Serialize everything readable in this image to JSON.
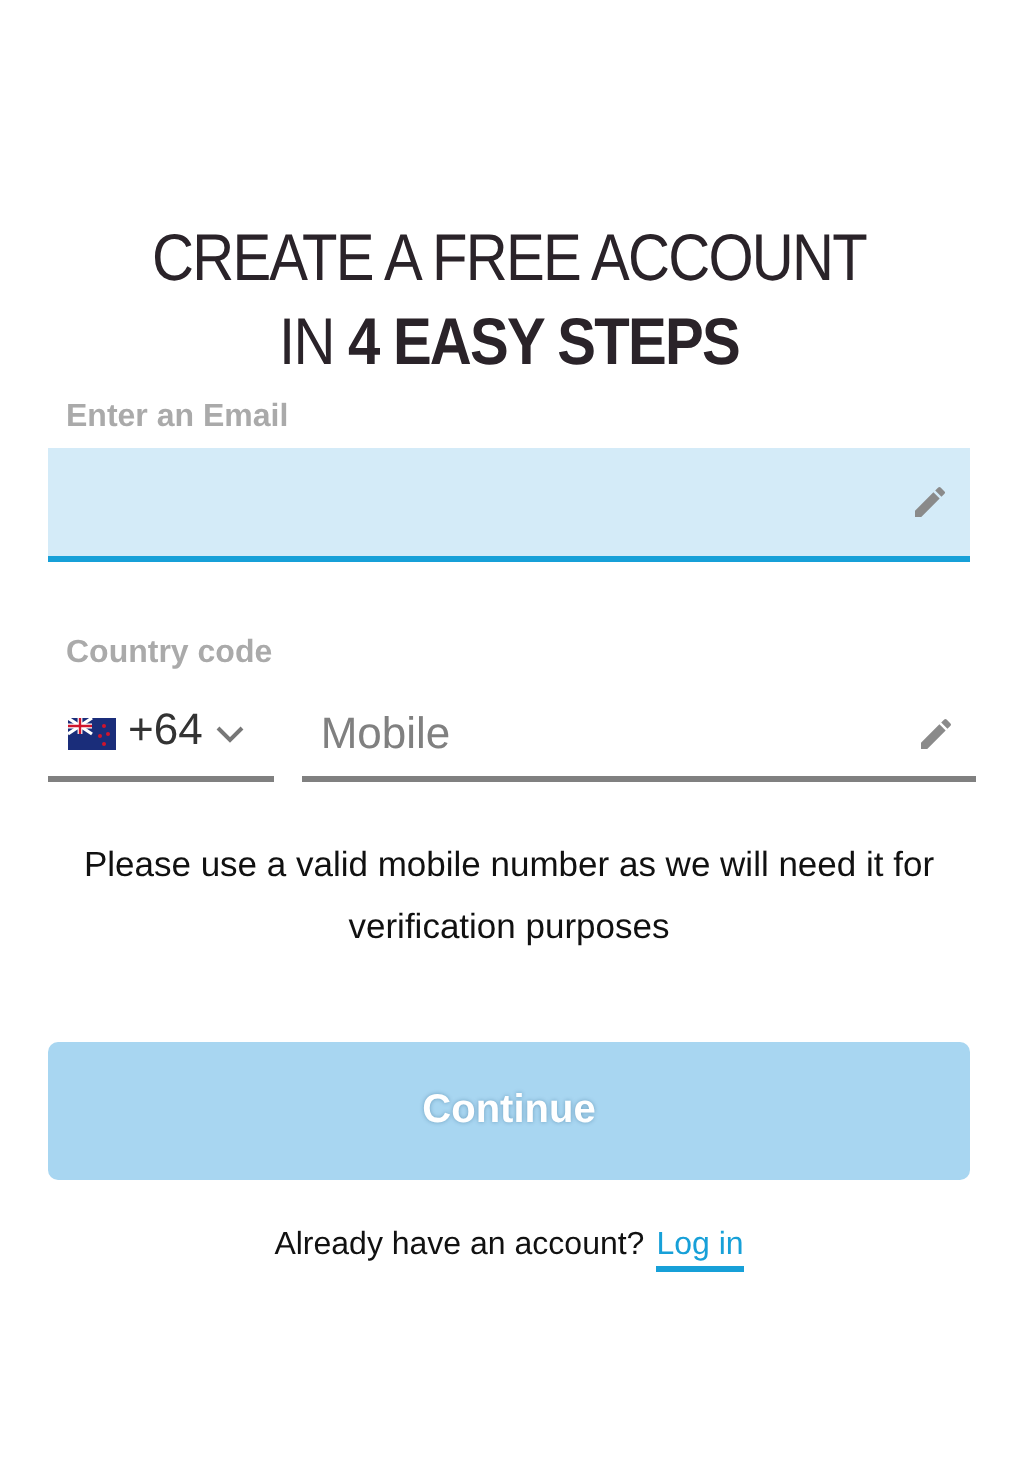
{
  "heading": [
    "CREATE A FREE ACCOUNT",
    "IN **4 EASY STEPS**"
  ],
  "email": {
    "label": "Enter an Email",
    "focused": true
  },
  "phone": {
    "label": "Country code",
    "code": "+64",
    "placeholder": "Mobile"
  },
  "note": "Please use a valid mobile number as we will need it for verification purposes",
  "continue": {
    "label": "Continue",
    "disabled": true
  },
  "footer": {
    "text": "Already have an account?",
    "link": "Log in"
  }
}
